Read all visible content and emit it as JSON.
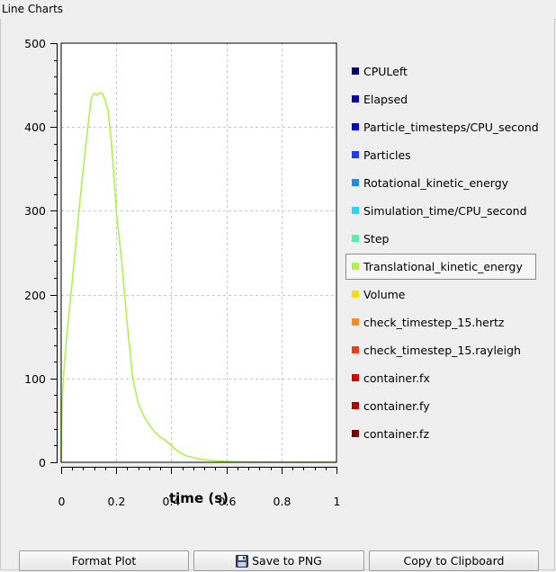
{
  "window": {
    "title": "Line Charts"
  },
  "chart_data": {
    "type": "line",
    "xlabel": "time (s)",
    "ylabel": "",
    "xlim": [
      0,
      1
    ],
    "ylim": [
      0,
      500
    ],
    "x_ticks": [
      "0",
      "0.2",
      "0.4",
      "0.6",
      "0.8",
      "1"
    ],
    "y_ticks": [
      "0",
      "100",
      "200",
      "300",
      "400",
      "500"
    ],
    "grid": true,
    "legend_position": "right",
    "series": [
      {
        "name": "Translational_kinetic_energy",
        "color": "#b0f24c",
        "x": [
          0,
          0.003,
          0.007,
          0.01,
          0.02,
          0.04,
          0.06,
          0.08,
          0.1,
          0.11,
          0.12,
          0.13,
          0.14,
          0.15,
          0.16,
          0.17,
          0.18,
          0.19,
          0.2,
          0.22,
          0.24,
          0.26,
          0.28,
          0.3,
          0.32,
          0.34,
          0.36,
          0.38,
          0.4,
          0.42,
          0.45,
          0.5,
          0.55,
          0.6,
          0.65,
          0.7,
          0.8,
          0.9,
          1.0
        ],
        "y": [
          0,
          60,
          95,
          110,
          150,
          215,
          285,
          350,
          410,
          435,
          440,
          438,
          441,
          440,
          432,
          420,
          390,
          350,
          300,
          240,
          165,
          100,
          70,
          55,
          45,
          36,
          30,
          26,
          20,
          14,
          8,
          4,
          2,
          1,
          0.5,
          0.3,
          0.2,
          0.1,
          0.1
        ]
      }
    ]
  },
  "legend": [
    {
      "label": "CPULeft",
      "color": "#000080"
    },
    {
      "label": "Elapsed",
      "color": "#0000b2"
    },
    {
      "label": "Particle_timesteps/CPU_second",
      "color": "#0000e8"
    },
    {
      "label": "Particles",
      "color": "#1a3cff"
    },
    {
      "label": "Rotational_kinetic_energy",
      "color": "#1c8cf0"
    },
    {
      "label": "Simulation_time/CPU_second",
      "color": "#2ad4f2"
    },
    {
      "label": "Step",
      "color": "#54f0a8"
    },
    {
      "label": "Translational_kinetic_energy",
      "color": "#b0f24c",
      "selected": true
    },
    {
      "label": "Volume",
      "color": "#f6dc12"
    },
    {
      "label": "check_timestep_15.hertz",
      "color": "#ff8a1a"
    },
    {
      "label": "check_timestep_15.rayleigh",
      "color": "#f23a1a"
    },
    {
      "label": "container.fx",
      "color": "#e00000"
    },
    {
      "label": "container.fy",
      "color": "#b40000"
    },
    {
      "label": "container.fz",
      "color": "#800000"
    }
  ],
  "buttons": {
    "format_plot": "Format Plot",
    "save_png": "Save to PNG",
    "copy_clipboard": "Copy to Clipboard"
  }
}
